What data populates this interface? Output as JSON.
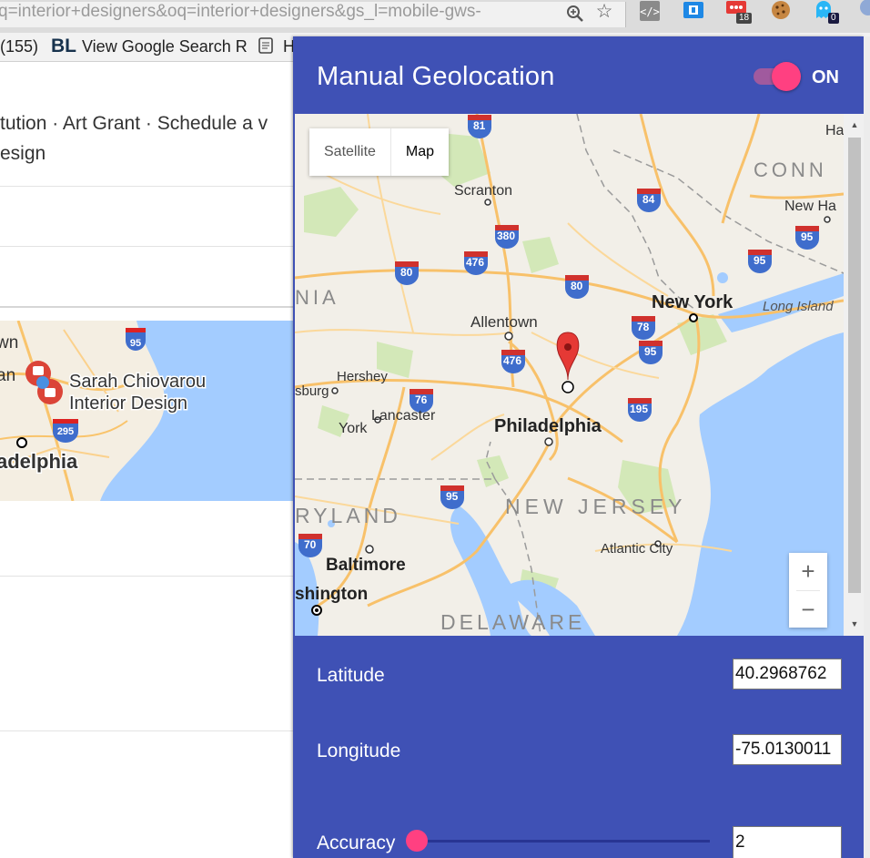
{
  "browser": {
    "url_text": "q=interior+designers&oq=interior+designers&gs_l=mobile-gws-",
    "extensions": [
      {
        "name": "devtools-extension-icon",
        "badge": ""
      },
      {
        "name": "reader-extension-icon",
        "badge": ""
      },
      {
        "name": "more-extension-icon",
        "badge": "18"
      },
      {
        "name": "cookie-extension-icon",
        "badge": ""
      },
      {
        "name": "ghost-extension-icon",
        "badge": "0"
      }
    ],
    "bookmarks": [
      {
        "label": "(155)"
      },
      {
        "label": "View Google Search R"
      },
      {
        "label": "H"
      }
    ]
  },
  "background_page": {
    "line1": "tution · Art Grant · Schedule a v",
    "line2": "esign",
    "map": {
      "label_town": "wn",
      "label_an": "an",
      "business_name_line1": "Sarah Chiovarou",
      "business_name_line2": "Interior Design",
      "city": "adelphia",
      "shield_95": "95",
      "shield_295": "295"
    }
  },
  "popup": {
    "title": "Manual Geolocation",
    "toggle_label": "ON",
    "toggle_on": true,
    "map_type": {
      "satellite": "Satellite",
      "map": "Map",
      "selected": "Map"
    },
    "zoom_in": "+",
    "zoom_out": "−",
    "map_labels": {
      "scranton": "Scranton",
      "allentown": "Allentown",
      "hershey": "Hershey",
      "lancaster": "Lancaster",
      "york": "York",
      "philadelphia": "Philadelphia",
      "new_york": "New York",
      "long_island": "Long Island",
      "new_haven": "New Ha",
      "conn": "CONN",
      "nia": "NIA",
      "burg": "sburg",
      "ha": "Ha",
      "new_jersey": "NEW JERSEY",
      "atlantic_city": "Atlantic City",
      "ryland": "RYLAND",
      "baltimore": "Baltimore",
      "washington": "shington",
      "delaware": "DELAWARE"
    },
    "shields": {
      "i81": "81",
      "i84": "84",
      "i380": "380",
      "i476a": "476",
      "i80a": "80",
      "i80b": "80",
      "i95a": "95",
      "i95b": "95",
      "i78": "78",
      "i95c": "95",
      "i476b": "476",
      "i76": "76",
      "i195": "195",
      "i95d": "95",
      "i70": "70"
    },
    "latitude_label": "Latitude",
    "latitude_value": "40.2968762",
    "longitude_label": "Longitude",
    "longitude_value": "-75.0130011",
    "accuracy_label": "Accuracy",
    "accuracy_value": "2",
    "accuracy_slider_fraction": 0.0
  }
}
